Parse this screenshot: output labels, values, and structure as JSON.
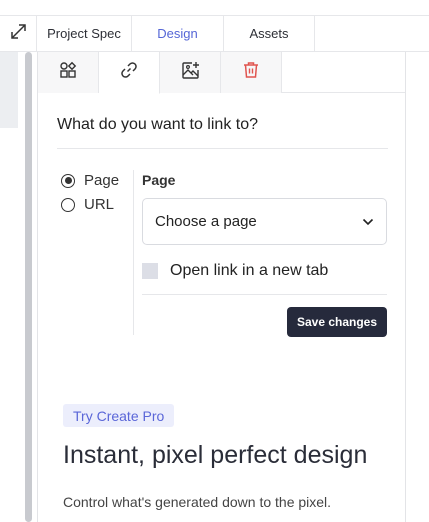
{
  "tabs": [
    {
      "label": "Project Spec",
      "active": false
    },
    {
      "label": "Design",
      "active": true
    },
    {
      "label": "Assets",
      "active": false
    }
  ],
  "toolbar": {
    "buttons": [
      {
        "icon": "components-icon",
        "active": false
      },
      {
        "icon": "link-icon",
        "active": true
      },
      {
        "icon": "add-image-icon",
        "active": false
      },
      {
        "icon": "trash-icon",
        "active": false
      }
    ]
  },
  "link_form": {
    "heading": "What do you want to link to?",
    "options": [
      {
        "label": "Page",
        "selected": true
      },
      {
        "label": "URL",
        "selected": false
      }
    ],
    "field_label": "Page",
    "select_value": "Choose a page",
    "new_tab_label": "Open link in a new tab",
    "new_tab_checked": false,
    "save_label": "Save changes"
  },
  "promo": {
    "badge": "Try Create Pro",
    "title": "Instant, pixel perfect design",
    "text": "Control what's generated down to the pixel."
  },
  "colors": {
    "accent": "#5566d6",
    "danger": "#e0544f",
    "button_dark": "#262a3c"
  }
}
